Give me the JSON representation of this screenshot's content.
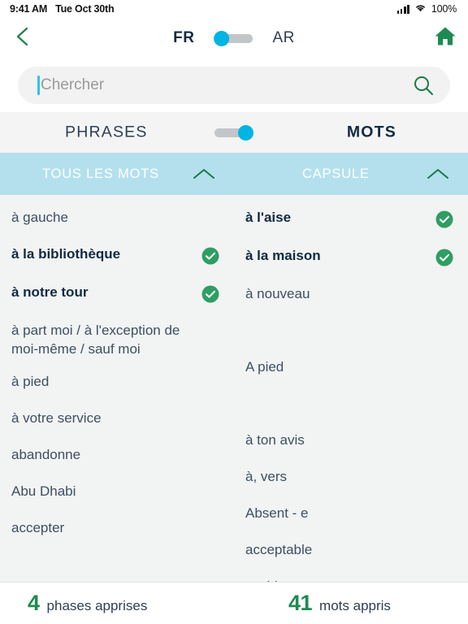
{
  "status_bar": {
    "time": "9:41 AM",
    "date": "Tue Oct 30th",
    "battery": "100%",
    "signal_icon": "cellular-bars-icon",
    "wifi_icon": "wifi-icon"
  },
  "nav": {
    "back_icon": "chevron-left-icon",
    "home_icon": "home-icon",
    "lang_left": "FR",
    "lang_right": "AR",
    "lang_toggle_position": "left"
  },
  "search": {
    "placeholder": "Chercher",
    "value": "",
    "icon": "search-icon"
  },
  "mode": {
    "left_label": "PHRASES",
    "right_label": "MOTS",
    "toggle_position": "right"
  },
  "columns": [
    {
      "title": "TOUS LES MOTS",
      "chevron_icon": "chevron-up-icon"
    },
    {
      "title": "CAPSULE",
      "chevron_icon": "chevron-up-icon"
    }
  ],
  "left_list": [
    {
      "label": "à gauche",
      "learned": false
    },
    {
      "label": "à la bibliothèque",
      "learned": true
    },
    {
      "label": "à notre tour",
      "learned": true
    },
    {
      "label": "à part moi / à l'exception de moi-même / sauf moi",
      "learned": false
    },
    {
      "label": "à pied",
      "learned": false
    },
    {
      "label": "à votre service",
      "learned": false
    },
    {
      "label": "abandonne",
      "learned": false
    },
    {
      "label": "Abu Dhabi",
      "learned": false
    },
    {
      "label": "accepter",
      "learned": false
    }
  ],
  "right_list": [
    {
      "label": "à l'aise",
      "learned": true
    },
    {
      "label": "à la maison",
      "learned": true
    },
    {
      "label": "à nouveau",
      "learned": false
    },
    {
      "label": "",
      "learned": false
    },
    {
      "label": "A pied",
      "learned": false
    },
    {
      "label": "",
      "learned": false
    },
    {
      "label": "à ton avis",
      "learned": false
    },
    {
      "label": "à, vers",
      "learned": false
    },
    {
      "label": "Absent - e",
      "learned": false
    },
    {
      "label": "acceptable",
      "learned": false
    },
    {
      "label": "accident",
      "learned": false
    }
  ],
  "footer": {
    "phrases_count": "4",
    "phrases_label": "phases apprises",
    "words_count": "41",
    "words_label": "mots appris"
  },
  "colors": {
    "accent_cyan": "#00b4e3",
    "green": "#1e8b52",
    "header_blue": "#b4e0ee",
    "navy": "#102a43",
    "list_bg": "#f2f3f3"
  }
}
